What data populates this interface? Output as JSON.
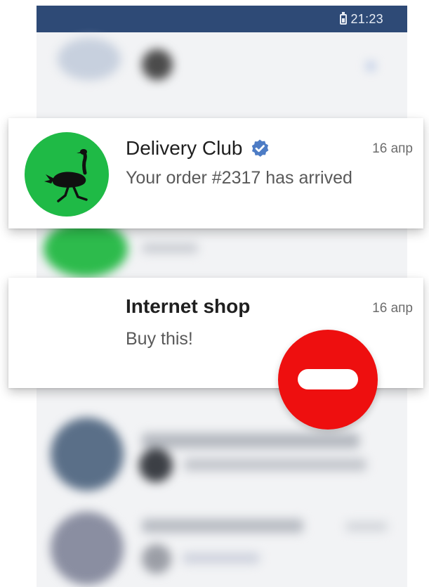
{
  "status_bar": {
    "time": "21:23",
    "battery_icon": "battery-icon"
  },
  "notifications": [
    {
      "title": "Delivery Club",
      "verified": true,
      "date": "16 апр",
      "message": "Your order #2317 has arrived",
      "avatar_color": "#1fba46",
      "avatar_icon": "ostrich-icon"
    },
    {
      "title": "Internet shop",
      "verified": false,
      "date": "16 апр",
      "message": "Buy this!"
    }
  ],
  "block_button": {
    "icon": "minus-icon",
    "color": "#ee0f0f"
  },
  "colors": {
    "header": "#2e4a76",
    "verified": "#4d7cc5",
    "text_primary": "#1f1f1f",
    "text_secondary": "#595959"
  }
}
